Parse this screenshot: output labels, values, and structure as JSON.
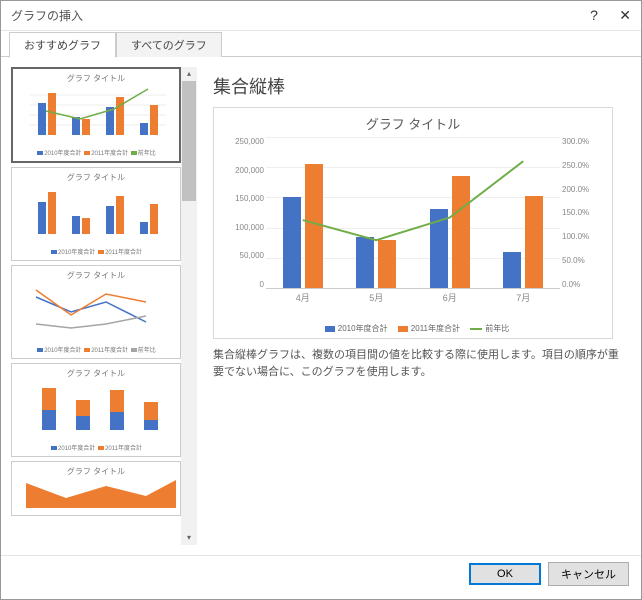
{
  "titlebar": {
    "title": "グラフの挿入",
    "help": "?",
    "close": "✕"
  },
  "tabs": {
    "recommended": "おすすめグラフ",
    "all": "すべてのグラフ"
  },
  "thumb_title": "グラフ タイトル",
  "thumb_legend": {
    "s1": "2010年度合計",
    "s2": "2011年度合計",
    "s3": "前年比"
  },
  "preview": {
    "heading": "集合縦棒",
    "desc": "集合縦棒グラフは、複数の項目間の値を比較する際に使用します。項目の順序が重要でない場合に、このグラフを使用します。"
  },
  "chart_data": {
    "type": "bar",
    "title": "グラフ タイトル",
    "categories": [
      "4月",
      "5月",
      "6月",
      "7月"
    ],
    "series": [
      {
        "name": "2010年度合計",
        "color": "#4472c4",
        "values": [
          150000,
          85000,
          130000,
          60000
        ]
      },
      {
        "name": "2011年度合計",
        "color": "#ed7d31",
        "values": [
          205000,
          80000,
          185000,
          152000
        ]
      }
    ],
    "line_series": {
      "name": "前年比",
      "color": "#70ad47",
      "values": [
        135.0,
        95.0,
        140.0,
        252.0
      ]
    },
    "ylim_left": [
      0,
      250000
    ],
    "ylim_right": [
      0.0,
      300.0
    ],
    "yticks_left": [
      "250,000",
      "200,000",
      "150,000",
      "100,000",
      "50,000",
      "0"
    ],
    "yticks_right": [
      "300.0%",
      "250.0%",
      "200.0%",
      "150.0%",
      "100.0%",
      "50.0%",
      "0.0%"
    ]
  },
  "buttons": {
    "ok": "OK",
    "cancel": "キャンセル"
  }
}
